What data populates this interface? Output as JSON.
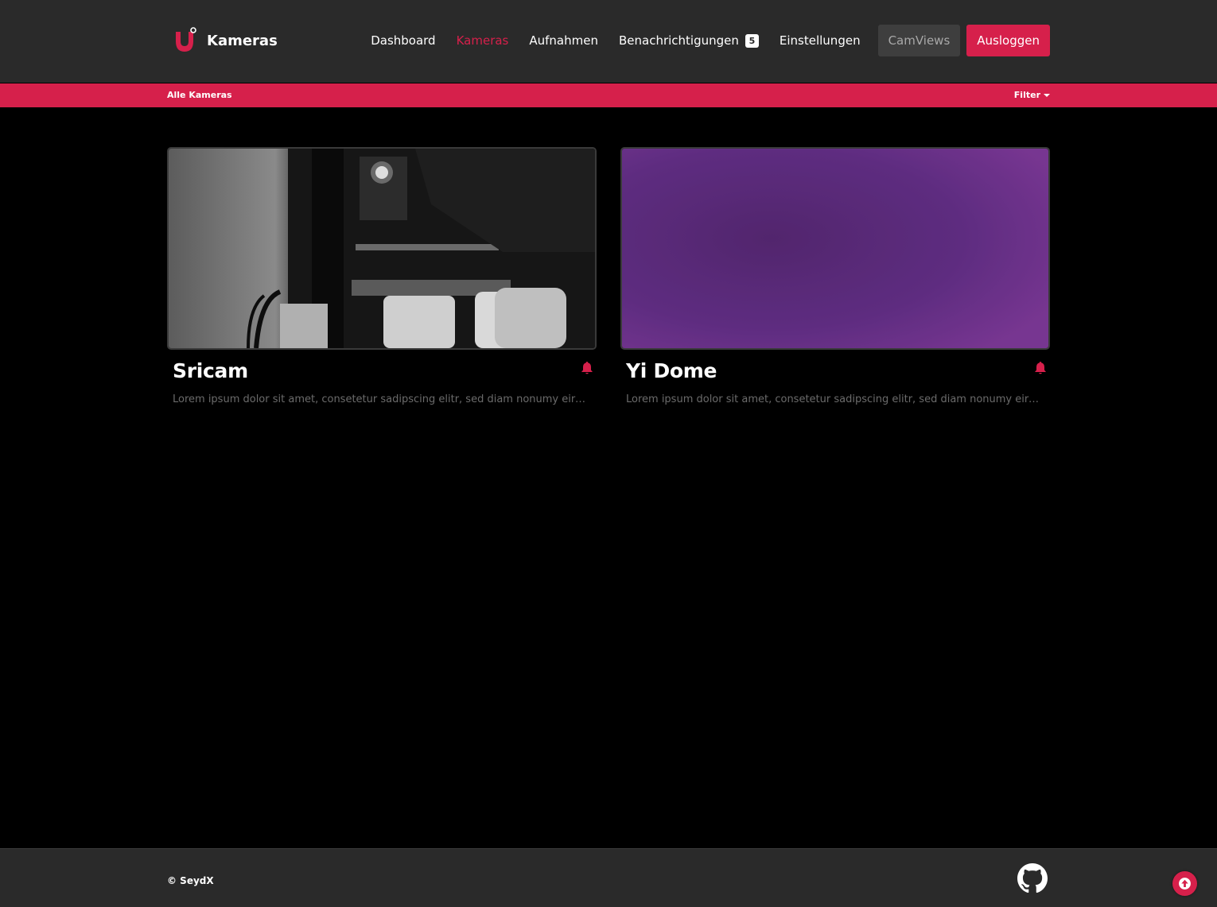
{
  "header": {
    "brand_title": "Kameras",
    "nav": [
      {
        "label": "Dashboard",
        "active": false
      },
      {
        "label": "Kameras",
        "active": true
      },
      {
        "label": "Aufnahmen",
        "active": false
      },
      {
        "label": "Benachrichtigungen",
        "active": false,
        "badge": "5"
      },
      {
        "label": "Einstellungen",
        "active": false
      }
    ],
    "camviews_label": "CamViews",
    "logout_label": "Ausloggen"
  },
  "subbar": {
    "left_label": "Alle Kameras",
    "filter_label": "Filter"
  },
  "cameras": [
    {
      "name": "Sricam",
      "description": "Lorem ipsum dolor sit amet, consetetur sadipscing elitr, sed diam nonumy eirmod tempor invidunt ut labore",
      "icon": "bell-icon"
    },
    {
      "name": "Yi Dome",
      "description": "Lorem ipsum dolor sit amet, consetetur sadipscing elitr, sed diam nonumy eirmod tempor invidunt ut labore",
      "icon": "bell-icon"
    }
  ],
  "footer": {
    "copyright": "© SeydX",
    "github_icon": "github-icon",
    "scroll_top_icon": "arrow-up-icon"
  },
  "colors": {
    "accent": "#d6204b",
    "navbar_bg": "#2a2a2a",
    "page_bg": "#000000",
    "muted_text": "#6b6b6b"
  }
}
